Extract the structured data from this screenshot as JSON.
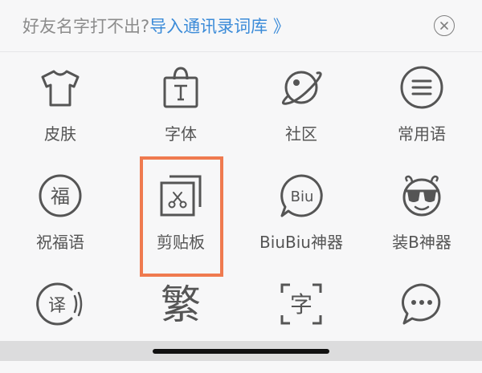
{
  "banner": {
    "prompt": "好友名字打不出?",
    "link": "导入通讯录词库 》"
  },
  "grid": {
    "items": [
      {
        "label": "皮肤",
        "icon": "tshirt-icon"
      },
      {
        "label": "字体",
        "icon": "font-bag-icon"
      },
      {
        "label": "社区",
        "icon": "planet-icon"
      },
      {
        "label": "常用语",
        "icon": "list-circle-icon"
      },
      {
        "label": "祝福语",
        "icon": "fu-blessing-icon",
        "glyph": "福"
      },
      {
        "label": "剪贴板",
        "icon": "clipboard-scissors-icon",
        "highlighted": true
      },
      {
        "label": "BiuBiu神器",
        "icon": "biu-bubble-icon",
        "glyph": "Biu"
      },
      {
        "label": "装B神器",
        "icon": "sunglasses-face-icon"
      },
      {
        "label": "",
        "icon": "translate-icon",
        "glyph": "译"
      },
      {
        "label": "",
        "icon": "traditional-chinese-icon",
        "glyph": "繁"
      },
      {
        "label": "",
        "icon": "character-scan-icon",
        "glyph": "字"
      },
      {
        "label": "",
        "icon": "chat-bubble-icon"
      }
    ]
  },
  "colors": {
    "link": "#3b8bd8",
    "highlight": "#ef7a4f",
    "icon_stroke": "#555555",
    "background": "#f7f7f8"
  }
}
